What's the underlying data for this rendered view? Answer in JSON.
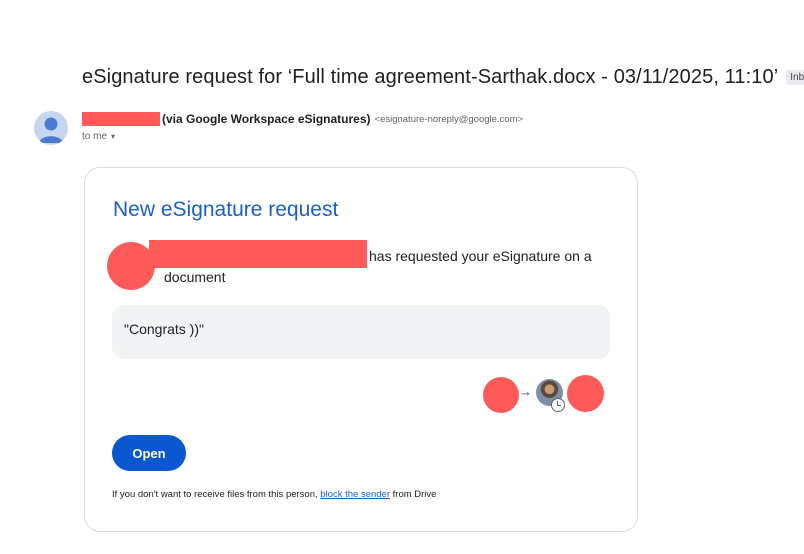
{
  "email": {
    "subject": "eSignature request for ‘Full time agreement-Sarthak.docx - 03/11/2025, 11:10’",
    "label_chip": "Inbox",
    "label_remove": "×",
    "sender": {
      "name_suffix": "(via Google Workspace eSignatures)",
      "email": "<esignature-noreply@google.com>"
    },
    "recipient": "to me",
    "recipient_caret": "▾"
  },
  "card": {
    "title": "New eSignature request",
    "request_text_1": "has requested your eSignature on a",
    "request_text_2": "document",
    "message": "\"Congrats ))\"",
    "flow_arrow": "→",
    "open_button": "Open",
    "footer": {
      "prefix": "If you don't want to receive files from this person,",
      "link": "block the sender",
      "suffix": "from Drive"
    }
  },
  "colors": {
    "title_blue": "#1a5fcc",
    "button_blue": "#0b57d0",
    "redaction_red": "#ff5a5a"
  }
}
